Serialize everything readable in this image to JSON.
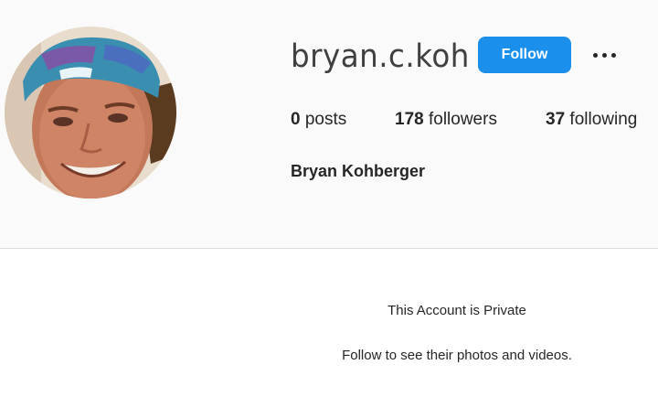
{
  "profile": {
    "username": "bryan.c.koh",
    "full_name": "Bryan Kohberger",
    "follow_label": "Follow",
    "more_icon": "more-horizontal-icon"
  },
  "stats": {
    "posts_count": "0",
    "posts_label": "posts",
    "followers_count": "178",
    "followers_label": "followers",
    "following_count": "37",
    "following_label": "following"
  },
  "private_notice": {
    "title": "This Account is Private",
    "subtitle": "Follow to see their photos and videos."
  },
  "colors": {
    "follow_button": "#1b8fec",
    "header_background": "#fafafa",
    "divider": "#dbdbdb"
  }
}
